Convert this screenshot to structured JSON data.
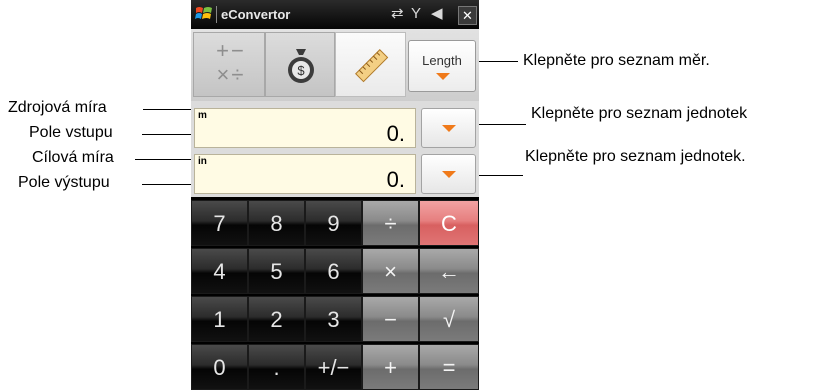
{
  "app": {
    "title": "eConvertor"
  },
  "toolbar": {
    "length_label": "Length"
  },
  "source": {
    "unit": "m",
    "value": "0."
  },
  "target": {
    "unit": "in",
    "value": "0."
  },
  "keypad": {
    "rows": [
      [
        "7",
        "8",
        "9",
        "÷",
        "C"
      ],
      [
        "4",
        "5",
        "6",
        "×",
        "←"
      ],
      [
        "1",
        "2",
        "3",
        "−",
        "√"
      ],
      [
        "0",
        ".",
        "+/−",
        "+",
        "="
      ]
    ]
  },
  "callouts": {
    "units_list": "Klepněte pro seznam měr.",
    "source_unit_list": "Klepněte pro seznam jednotek",
    "target_unit_list": "Klepněte pro seznam jednotek.",
    "source_measure": "Zdrojová míra",
    "input_field": "Pole vstupu",
    "target_measure": "Cílová míra",
    "output_field": "Pole výstupu"
  },
  "colors": {
    "accent_arrow": "#f07a1a",
    "clear_key": "#e67f7f",
    "field_bg": "#fffbe4"
  }
}
